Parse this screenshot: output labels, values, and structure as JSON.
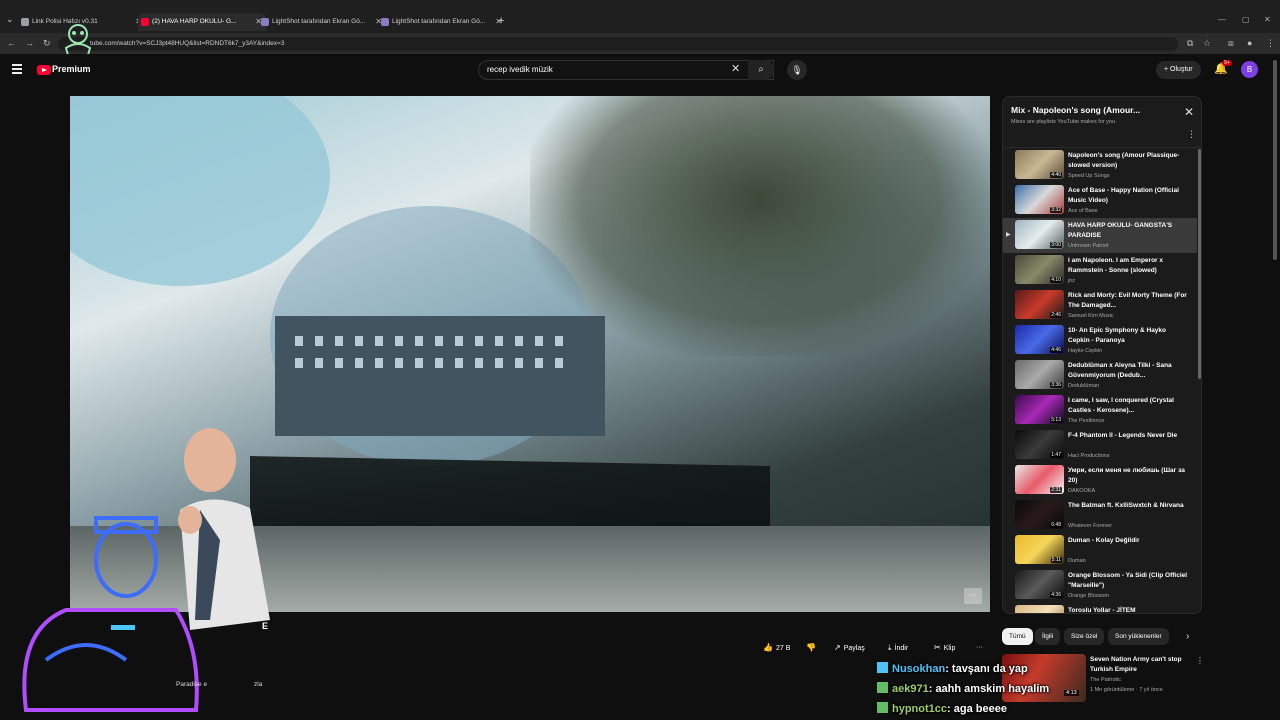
{
  "browser": {
    "tabs": [
      {
        "title": "Link Polisi Hafızı v0.31",
        "active": false,
        "fav_color": "#9aa0a6"
      },
      {
        "title": "(2) HAVA HARP OKULU- G...",
        "active": true,
        "fav_color": "#ff0033"
      },
      {
        "title": "LightShot tarafından Ekran Gö...",
        "active": false,
        "fav_color": "#8e7cc3"
      },
      {
        "title": "LightShot tarafından Ekran Gö...",
        "active": false,
        "fav_color": "#8e7cc3"
      }
    ],
    "url": "tube.com/watch?v=SCJ3pt48HUQ&list=RDNDT6k7_y3AY&index=3"
  },
  "header": {
    "premium_label": "Premium",
    "search_value": "recep ivedik müzik",
    "create_label": "Oluştur",
    "notification_count": "9+",
    "avatar_letter": "B"
  },
  "video": {
    "subtitle_fragment": "E",
    "description_fragment": "Paradise e",
    "description_fragment2": "zla"
  },
  "actions": {
    "like_count": "27 B",
    "share_label": "Paylaş",
    "download_label": "İndir",
    "clip_label": "Klip",
    "more_label": "···"
  },
  "playlist": {
    "title": "Mix - Napoleon's song (Amour...",
    "subtitle": "Mixes are playlists YouTube makes for you",
    "items": [
      {
        "title": "Napoleon's song (Amour Plassique- slowed version)",
        "channel": "Speed Up Songs",
        "duration": "4:40",
        "thumb": "linear-gradient(135deg,#8a7a5a,#c9b994,#5a4a3a)",
        "current": false,
        "marker": ""
      },
      {
        "title": "Ace of Base - Happy Nation (Official Music Video)",
        "channel": "Ace of Base",
        "duration": "3:32",
        "thumb": "linear-gradient(135deg,#3a6ea8,#d9d9d9,#a83a3a)",
        "current": false,
        "marker": ""
      },
      {
        "title": "HAVA HARP OKULU- GANGSTA'S PARADISE",
        "channel": "Unknown Patriot",
        "duration": "3:00",
        "thumb": "linear-gradient(135deg,#9fb7c0,#e5ecee,#50605c)",
        "current": true,
        "marker": "▶"
      },
      {
        "title": "I am Napoleon. I am Emperor x Rammstein - Sonne (slowed)",
        "channel": "jirz",
        "duration": "4:10",
        "thumb": "linear-gradient(135deg,#4a4a3a,#8a8a6a,#2a2a2a)",
        "current": false,
        "marker": ""
      },
      {
        "title": "Rick and Morty: Evil Morty Theme (For The Damaged...",
        "channel": "Samuel Kim Music",
        "duration": "2:46",
        "thumb": "linear-gradient(135deg,#5a1a1a,#c93a2a,#1a1a1a)",
        "current": false,
        "marker": ""
      },
      {
        "title": "10- An Epic Symphony & Hayko Cepkin - Paranoya",
        "channel": "Hayko Cepkin",
        "duration": "4:46",
        "thumb": "linear-gradient(135deg,#1a2aa8,#4a6ae8,#0a0a4a)",
        "current": false,
        "marker": ""
      },
      {
        "title": "Dedublüman x Aleyna Tilki - Sana Güvenmiyorum (Dedub...",
        "channel": "Dedublüman",
        "duration": "3:36",
        "thumb": "linear-gradient(135deg,#6a6a6a,#aaaaaa,#3a3a3a)",
        "current": false,
        "marker": ""
      },
      {
        "title": "I came, I saw, I conquered (Crystal Castles - Kerosene)...",
        "channel": "The Pestilence",
        "duration": "5:13",
        "thumb": "linear-gradient(135deg,#3a0a4a,#a82ab8,#0a0a1a)",
        "current": false,
        "marker": ""
      },
      {
        "title": "F-4 Phantom II - Legends Never Die",
        "channel": "Haci Productions",
        "duration": "1:47",
        "thumb": "linear-gradient(135deg,#0a0a0a,#3a3a3a,#0a0a0a)",
        "current": false,
        "marker": ""
      },
      {
        "title": "Умри, если меня не любишь (Шаг за 20)",
        "channel": "DAKOOKA",
        "duration": "2:31",
        "thumb": "linear-gradient(135deg,#e8e8e8,#e85a6a,#f5f5f5)",
        "current": false,
        "marker": ""
      },
      {
        "title": "The Batman ft. KxlliSwxtch & Nirvana",
        "channel": "Whatever Forever",
        "duration": "6:48",
        "thumb": "linear-gradient(135deg,#0a0a0a,#2a1a1a,#0a0a0a)",
        "current": false,
        "marker": ""
      },
      {
        "title": "Duman - Kolay Değildir",
        "channel": "Duman",
        "duration": "5:11",
        "thumb": "linear-gradient(135deg,#e8b82a,#f5d55a,#3a2a0a)",
        "current": false,
        "marker": ""
      },
      {
        "title": "Orange Blossom - Ya Sidi (Clip Officiel \"Marseille\")",
        "channel": "Orange Blossom",
        "duration": "4:36",
        "thumb": "linear-gradient(135deg,#1a1a1a,#5a5a5a,#0a0a0a)",
        "current": false,
        "marker": ""
      },
      {
        "title": "Toroslu Yollar - JİTEM",
        "channel": "",
        "duration": "",
        "thumb": "linear-gradient(135deg,#d9b88a,#f5e0b8,#8a6a3a)",
        "current": false,
        "marker": ""
      }
    ]
  },
  "chips": {
    "all": "Tümü",
    "related": "İlgili",
    "for_you": "Size özel",
    "recent": "Son yüklenenler"
  },
  "recommendation": {
    "title": "Seven Nation Army can't stop Turkish Empire",
    "channel": "The Patriotic",
    "meta": "1 Mn görüntüleme · 7 yıl önce",
    "duration": "4:13"
  },
  "chat": [
    {
      "user": "Nusokhan",
      "message": ": tavşanı da yap",
      "user_color": "#4fc3f7",
      "badge": "#4fc3f7"
    },
    {
      "user": "aek971",
      "message": ": aahh amskim hayalim",
      "user_color": "#9ccc65",
      "badge": "#66bb6a"
    },
    {
      "user": "hypnot1cc",
      "message": ": aga beeee",
      "user_color": "#9ccc65",
      "badge": "#66bb6a"
    }
  ]
}
